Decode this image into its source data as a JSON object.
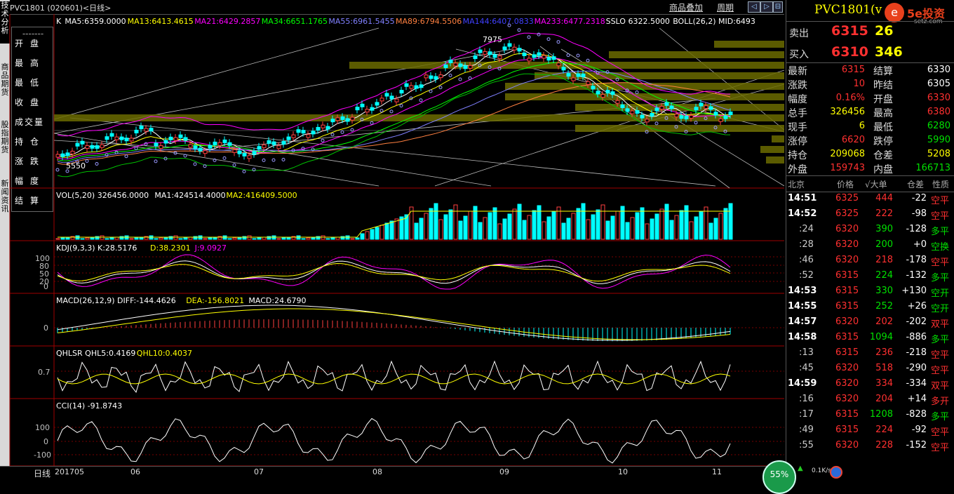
{
  "window": {
    "title": "PVC1801 (020601)<日线>",
    "menu_links": [
      "商品叠加",
      "周期"
    ],
    "nav_buttons": [
      "◁",
      "▷",
      "⊟",
      "⊞"
    ]
  },
  "left_tabs": [
    "技术分析",
    "商品期货",
    "股指期货",
    "新闻资讯"
  ],
  "info_panel": {
    "title": "-------",
    "rows": [
      "开盘",
      "最高",
      "最低",
      "收盘",
      "成交量",
      "持仓",
      "涨跌",
      "幅度",
      "结算"
    ]
  },
  "main_chart": {
    "legend": [
      {
        "text": "K",
        "color": "#ffffff"
      },
      {
        "text": "MA5:6359.0000",
        "color": "#ffffff"
      },
      {
        "text": "MA13:6413.4615",
        "color": "#ffff00"
      },
      {
        "text": "MA21:6429.2857",
        "color": "#ff00ff"
      },
      {
        "text": "MA34:6651.1765",
        "color": "#00ff00"
      },
      {
        "text": "MA55:6961.5455",
        "color": "#8080ff"
      },
      {
        "text": "MA89:6794.5506",
        "color": "#ff8040"
      },
      {
        "text": "MA144:6407.0833",
        "color": "#4040ff"
      },
      {
        "text": "MA233:6477.2318",
        "color": "#ff00ff"
      },
      {
        "text": "SSLO 6322.5000",
        "color": "#ffffff"
      },
      {
        "text": "BOLL(26,2) MID:6493",
        "color": "#ffffff"
      }
    ],
    "high_label": "7975",
    "low_label": "5550"
  },
  "vol_panel": {
    "legend": [
      {
        "text": "VOL(5,20) 326456.0000",
        "color": "#ffffff"
      },
      {
        "text": "MA1:424514.4000",
        "color": "#ffffff"
      },
      {
        "text": "MA2:416409.5000",
        "color": "#ffff00"
      }
    ]
  },
  "kdj_panel": {
    "legend": [
      {
        "text": "KDJ(9,3,3) K:28.5176",
        "color": "#ffffff"
      },
      {
        "text": "D:38.2301",
        "color": "#ffff00"
      },
      {
        "text": "J:9.0927",
        "color": "#ff00ff"
      }
    ],
    "axis": [
      "100",
      "80",
      "50",
      "20",
      "0"
    ]
  },
  "macd_panel": {
    "legend": [
      {
        "text": "MACD(26,12,9) DIFF:-144.4626",
        "color": "#ffffff"
      },
      {
        "text": "DEA:-156.8021",
        "color": "#ffff00"
      },
      {
        "text": "MACD:24.6790",
        "color": "#ffffff"
      }
    ],
    "axis": [
      "0"
    ]
  },
  "qhlsr_panel": {
    "legend": [
      {
        "text": "QHLSR QHL5:0.4169",
        "color": "#ffffff"
      },
      {
        "text": "QHL10:0.4037",
        "color": "#ffff00"
      }
    ],
    "axis": [
      "0.7"
    ]
  },
  "cci_panel": {
    "legend": [
      {
        "text": "CCI(14) -91.8743",
        "color": "#ffffff"
      }
    ],
    "axis": [
      "100",
      "0",
      "-100"
    ]
  },
  "x_axis": {
    "period_label": "日线",
    "labels": [
      "201705",
      "06",
      "07",
      "08",
      "09",
      "10",
      "11"
    ]
  },
  "quote": {
    "symbol": "PVC1801",
    "symbol_suffix": "(v",
    "logo_text": "5e投资",
    "logo_sub": "setz.com",
    "sell_label": "卖出",
    "sell_price": "6315",
    "sell_qty": "26",
    "buy_label": "买入",
    "buy_price": "6310",
    "buy_qty": "346",
    "stats": [
      {
        "l1": "最新",
        "v1": "6315",
        "c1": "red",
        "l2": "结算",
        "v2": "6330",
        "c2": "wht"
      },
      {
        "l1": "涨跌",
        "v1": "10",
        "c1": "red",
        "l2": "昨结",
        "v2": "6305",
        "c2": "wht"
      },
      {
        "l1": "幅度",
        "v1": "0.16%",
        "c1": "red",
        "l2": "开盘",
        "v2": "6330",
        "c2": "red"
      },
      {
        "l1": "总手",
        "v1": "326456",
        "c1": "yel",
        "l2": "最高",
        "v2": "6380",
        "c2": "red"
      },
      {
        "l1": "现手",
        "v1": "6",
        "c1": "yel",
        "l2": "最低",
        "v2": "6280",
        "c2": "grn"
      },
      {
        "l1": "涨停",
        "v1": "6620",
        "c1": "red",
        "l2": "跌停",
        "v2": "5990",
        "c2": "grn"
      },
      {
        "l1": "持仓",
        "v1": "209068",
        "c1": "yel",
        "l2": "仓差",
        "v2": "5208",
        "c2": "yel"
      },
      {
        "l1": "外盘",
        "v1": "159743",
        "c1": "red",
        "l2": "内盘",
        "v2": "166713",
        "c2": "grn"
      }
    ],
    "tick_header": [
      "北京",
      "价格",
      "√大单",
      "仓差",
      "性质"
    ],
    "ticks": [
      {
        "time": "14:51",
        "price": "6325",
        "pc": "red",
        "vol": "444",
        "vc": "red",
        "diff": "-22",
        "type": "空平",
        "tc": "red"
      },
      {
        "time": "14:52",
        "price": "6325",
        "pc": "red",
        "vol": "222",
        "vc": "red",
        "diff": "-98",
        "type": "空平",
        "tc": "red"
      },
      {
        "time": ":24",
        "price": "6320",
        "pc": "red",
        "vol": "390",
        "vc": "grn",
        "diff": "-128",
        "type": "多平",
        "tc": "grn"
      },
      {
        "time": ":28",
        "price": "6320",
        "pc": "red",
        "vol": "200",
        "vc": "grn",
        "diff": "+0",
        "type": "空换",
        "tc": "grn"
      },
      {
        "time": ":46",
        "price": "6320",
        "pc": "red",
        "vol": "218",
        "vc": "red",
        "diff": "-178",
        "type": "空平",
        "tc": "red"
      },
      {
        "time": ":52",
        "price": "6315",
        "pc": "red",
        "vol": "224",
        "vc": "grn",
        "diff": "-132",
        "type": "多平",
        "tc": "grn"
      },
      {
        "time": "14:53",
        "price": "6315",
        "pc": "red",
        "vol": "330",
        "vc": "grn",
        "diff": "+130",
        "type": "空开",
        "tc": "grn"
      },
      {
        "time": "14:55",
        "price": "6315",
        "pc": "red",
        "vol": "252",
        "vc": "grn",
        "diff": "+26",
        "type": "空开",
        "tc": "grn"
      },
      {
        "time": "14:57",
        "price": "6320",
        "pc": "red",
        "vol": "202",
        "vc": "red",
        "diff": "-202",
        "type": "双平",
        "tc": "red"
      },
      {
        "time": "14:58",
        "price": "6315",
        "pc": "red",
        "vol": "1094",
        "vc": "grn",
        "diff": "-886",
        "type": "多平",
        "tc": "grn"
      },
      {
        "time": ":13",
        "price": "6315",
        "pc": "red",
        "vol": "236",
        "vc": "red",
        "diff": "-218",
        "type": "空平",
        "tc": "red"
      },
      {
        "time": ":45",
        "price": "6320",
        "pc": "red",
        "vol": "518",
        "vc": "red",
        "diff": "-290",
        "type": "空平",
        "tc": "red"
      },
      {
        "time": "14:59",
        "price": "6320",
        "pc": "red",
        "vol": "334",
        "vc": "red",
        "diff": "-334",
        "type": "双平",
        "tc": "red"
      },
      {
        "time": ":16",
        "price": "6320",
        "pc": "red",
        "vol": "204",
        "vc": "red",
        "diff": "+14",
        "type": "多开",
        "tc": "red"
      },
      {
        "time": ":17",
        "price": "6315",
        "pc": "red",
        "vol": "1208",
        "vc": "grn",
        "diff": "-828",
        "type": "多平",
        "tc": "grn"
      },
      {
        "time": ":49",
        "price": "6315",
        "pc": "red",
        "vol": "224",
        "vc": "red",
        "diff": "-92",
        "type": "空平",
        "tc": "red"
      },
      {
        "time": ":55",
        "price": "6320",
        "pc": "red",
        "vol": "228",
        "vc": "red",
        "diff": "-152",
        "type": "空平",
        "tc": "red"
      }
    ]
  },
  "statusbar": {
    "percent": "55%",
    "speed": "0.1K/s"
  }
}
